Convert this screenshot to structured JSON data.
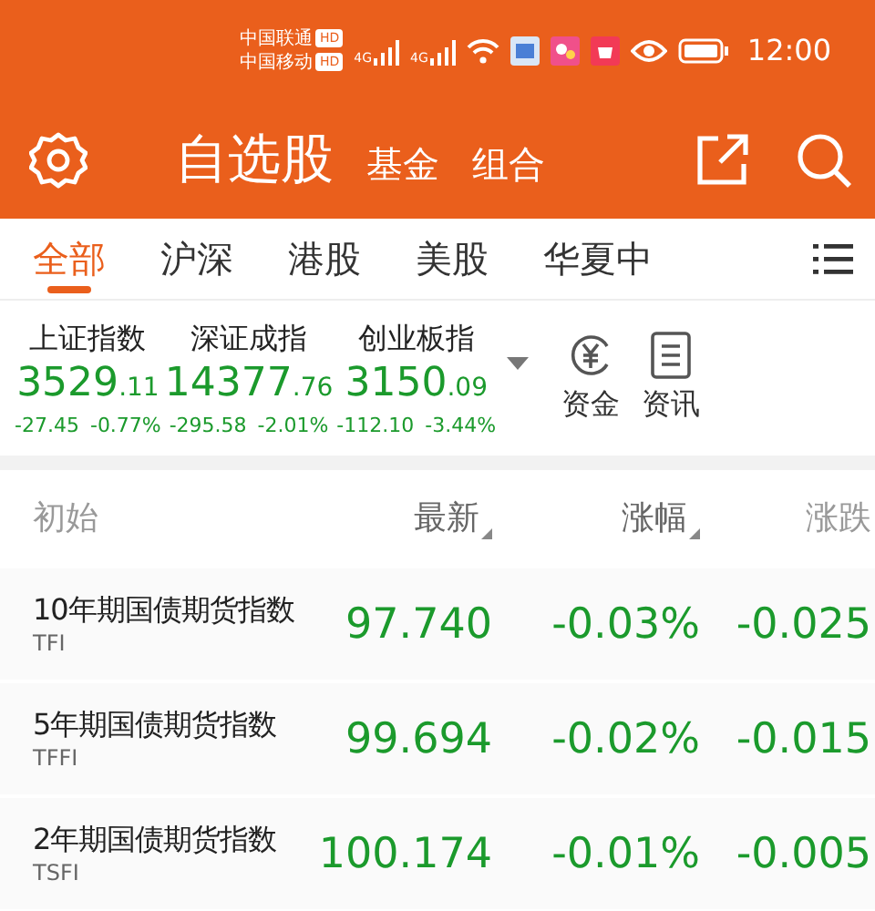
{
  "status_bar": {
    "carriers": [
      {
        "name": "中国联通",
        "badge": "HD"
      },
      {
        "name": "中国移动",
        "badge": "HD"
      }
    ],
    "signals": [
      "4G",
      "4G"
    ],
    "time": "12:00"
  },
  "header": {
    "tabs": [
      {
        "label": "自选股",
        "selected": true
      },
      {
        "label": "基金",
        "selected": false
      },
      {
        "label": "组合",
        "selected": false
      }
    ]
  },
  "market_tabs": [
    {
      "label": "全部",
      "selected": true
    },
    {
      "label": "沪深",
      "selected": false
    },
    {
      "label": "港股",
      "selected": false
    },
    {
      "label": "美股",
      "selected": false
    },
    {
      "label": "华夏中",
      "selected": false
    }
  ],
  "indices": [
    {
      "name": "上证指数",
      "value": "3529",
      "decimals": ".11",
      "change": "-27.45",
      "percent": "-0.77%"
    },
    {
      "name": "深证成指",
      "value": "14377",
      "decimals": ".76",
      "change": "-295.58",
      "percent": "-2.01%"
    },
    {
      "name": "创业板指",
      "value": "3150",
      "decimals": ".09",
      "change": "-112.10",
      "percent": "-3.44%"
    }
  ],
  "shortcuts": [
    {
      "label": "资金",
      "kind": "yuan"
    },
    {
      "label": "资讯",
      "kind": "news"
    }
  ],
  "table": {
    "columns": [
      {
        "label": "初始",
        "sortable": false
      },
      {
        "label": "最新",
        "sortable": true
      },
      {
        "label": "涨幅",
        "sortable": true
      },
      {
        "label": "涨跌"
      }
    ],
    "rows": [
      {
        "name": "10年期国债期货指数",
        "code": "TFI",
        "price": "97.740",
        "percent": "-0.03%",
        "change": "-0.025"
      },
      {
        "name": "5年期国债期货指数",
        "code": "TFFI",
        "price": "99.694",
        "percent": "-0.02%",
        "change": "-0.015"
      },
      {
        "name": "2年期国债期货指数",
        "code": "TSFI",
        "price": "100.174",
        "percent": "-0.01%",
        "change": "-0.005"
      }
    ]
  }
}
